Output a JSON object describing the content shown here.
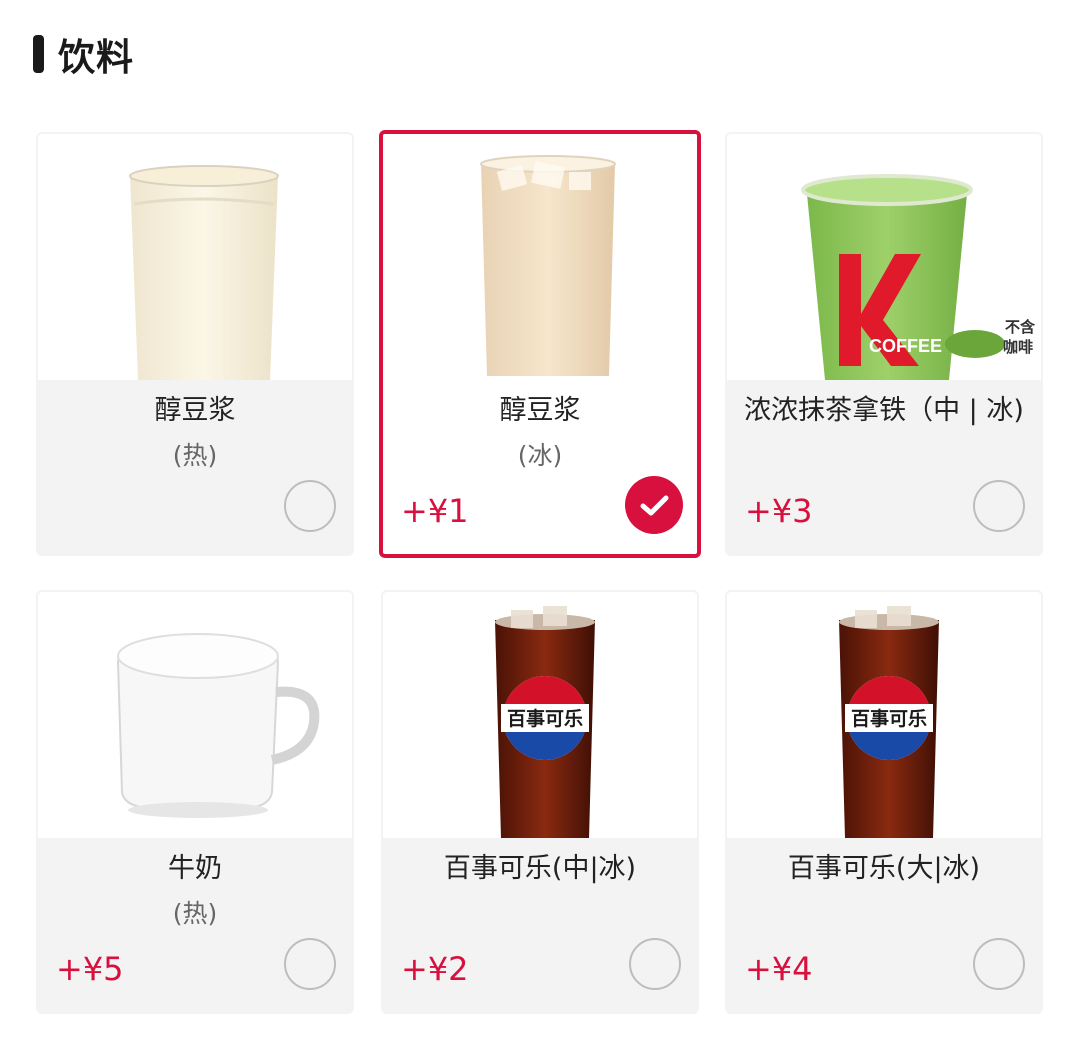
{
  "section": {
    "title": "饮料"
  },
  "items": [
    {
      "name": "醇豆浆",
      "sub": "(热)",
      "price": "",
      "selected": false,
      "image_icon": "soy-milk-glass-icon"
    },
    {
      "name": "醇豆浆",
      "sub": "(冰)",
      "price": "+¥1",
      "selected": true,
      "image_icon": "iced-soy-milk-glass-icon"
    },
    {
      "name": "浓浓抹茶拿铁（中 | 冰)",
      "sub": "",
      "price": "+¥3",
      "selected": false,
      "image_icon": "matcha-latte-cup-icon",
      "badge_line1": "不含",
      "badge_line2": "咖啡",
      "cup_label": "COFFEE",
      "cup_letter": "K"
    },
    {
      "name": "牛奶",
      "sub": "(热)",
      "price": "+¥5",
      "selected": false,
      "image_icon": "milk-mug-icon"
    },
    {
      "name": "百事可乐(中|冰)",
      "sub": "",
      "price": "+¥2",
      "selected": false,
      "image_icon": "pepsi-cola-glass-icon",
      "logo_text": "百事可乐"
    },
    {
      "name": "百事可乐(大|冰)",
      "sub": "",
      "price": "+¥4",
      "selected": false,
      "image_icon": "pepsi-cola-glass-icon",
      "logo_text": "百事可乐"
    }
  ],
  "colors": {
    "accent": "#d8103e",
    "card_bg": "#f3f3f3",
    "text": "#222222",
    "muted": "#666666"
  }
}
